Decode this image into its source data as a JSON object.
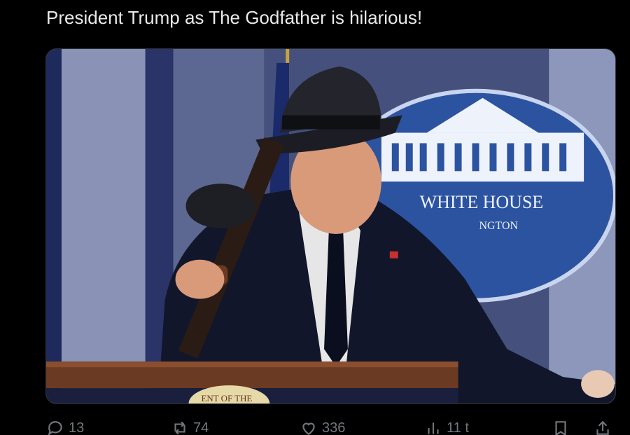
{
  "post": {
    "text": "President Trump as The Godfather is hilarious!"
  },
  "media": {
    "seal_text": "ENT OF THE",
    "backdrop_text_line1": "WHITE HOUSE",
    "backdrop_text_line2": "NGTON"
  },
  "actions": {
    "reply_count": "13",
    "repost_count": "74",
    "like_count": "336",
    "views_count": "11 t"
  },
  "icons": {
    "reply": "reply-icon",
    "repost": "repost-icon",
    "like": "heart-icon",
    "views": "views-chart-icon",
    "bookmark": "bookmark-icon",
    "share": "share-icon"
  },
  "colors": {
    "background": "#000000",
    "text": "#e7e9ea",
    "muted": "#71767b"
  }
}
